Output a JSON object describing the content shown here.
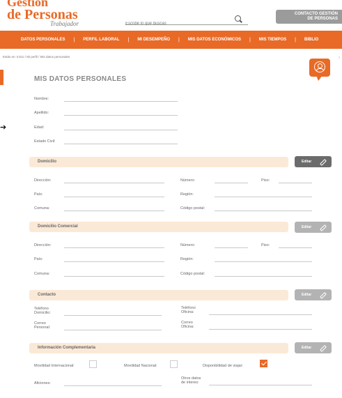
{
  "brand": {
    "top": "Gestión",
    "main": "de Personas",
    "sub": "Trabajador"
  },
  "search": {
    "placeholder": "Escribe lo que buscas"
  },
  "contact_button": {
    "line1": "CONTACTO GESTIÓN",
    "line2": "DE PERSONAS"
  },
  "nav": {
    "items": [
      "DATOS PERSONALES",
      "PERFIL LABORAL",
      "MI DESEMPEÑO",
      "MIS DATOS ECONÓMICOS",
      "MIS TIEMPOS",
      "BIBLIO"
    ],
    "separator": "|"
  },
  "breadcrumb": "Estás en: Inicio / Mi perfil / Mis datos personales",
  "page_title": "MIS DATOS PERSONALES",
  "personal": {
    "nombre": "Nombre:",
    "apellido": "Apellido:",
    "edad": "Edad:",
    "estado_civil": "Estado Civil:"
  },
  "domicilio": {
    "title": "Domicilio",
    "edit": "Editar",
    "direccion": "Dirección:",
    "numero": "Número:",
    "piso": "Piso:",
    "pais": "País:",
    "region": "Región:",
    "comuna": "Comuna:",
    "codigo_postal": "Código postal:"
  },
  "domicilio_comercial": {
    "title": "Domicilio Comercial",
    "edit": "Editar",
    "direccion": "Dirección:",
    "numero": "Número:",
    "piso": "Piso:",
    "pais": "País:",
    "region": "Región:",
    "comuna": "Comuna:",
    "codigo_postal": "Código postal:"
  },
  "contacto": {
    "title": "Contacto",
    "edit": "Editar",
    "telefono_domicilio_1": "Teléfono",
    "telefono_domicilio_2": "Domicilio:",
    "telefono_oficina_1": "Teléfono",
    "telefono_oficina_2": "Oficina:",
    "correo_personal_1": "Correo",
    "correo_personal_2": "Personal:",
    "correo_oficina_1": "Correo",
    "correo_oficina_2": "Oficina:"
  },
  "complementaria": {
    "title": "Información Complementaria",
    "edit": "Editar",
    "movilidad_internacional": "Movilidad Internacional:",
    "movilidad_nacional": "Movilidad Nacional:",
    "disponibilidad_viajar": "Disponibilidad de viajar:",
    "aficiones": "Aficiones:",
    "otros_1": "Otros datos",
    "otros_2": "de interes:"
  },
  "checkboxes": {
    "movilidad_internacional": false,
    "movilidad_nacional": false,
    "disponibilidad_viajar": true
  },
  "colors": {
    "accent": "#e86a26",
    "section_bg": "#fbe9d7",
    "edit_dark": "#6b6b6b",
    "edit_light": "#b3b3b3"
  }
}
